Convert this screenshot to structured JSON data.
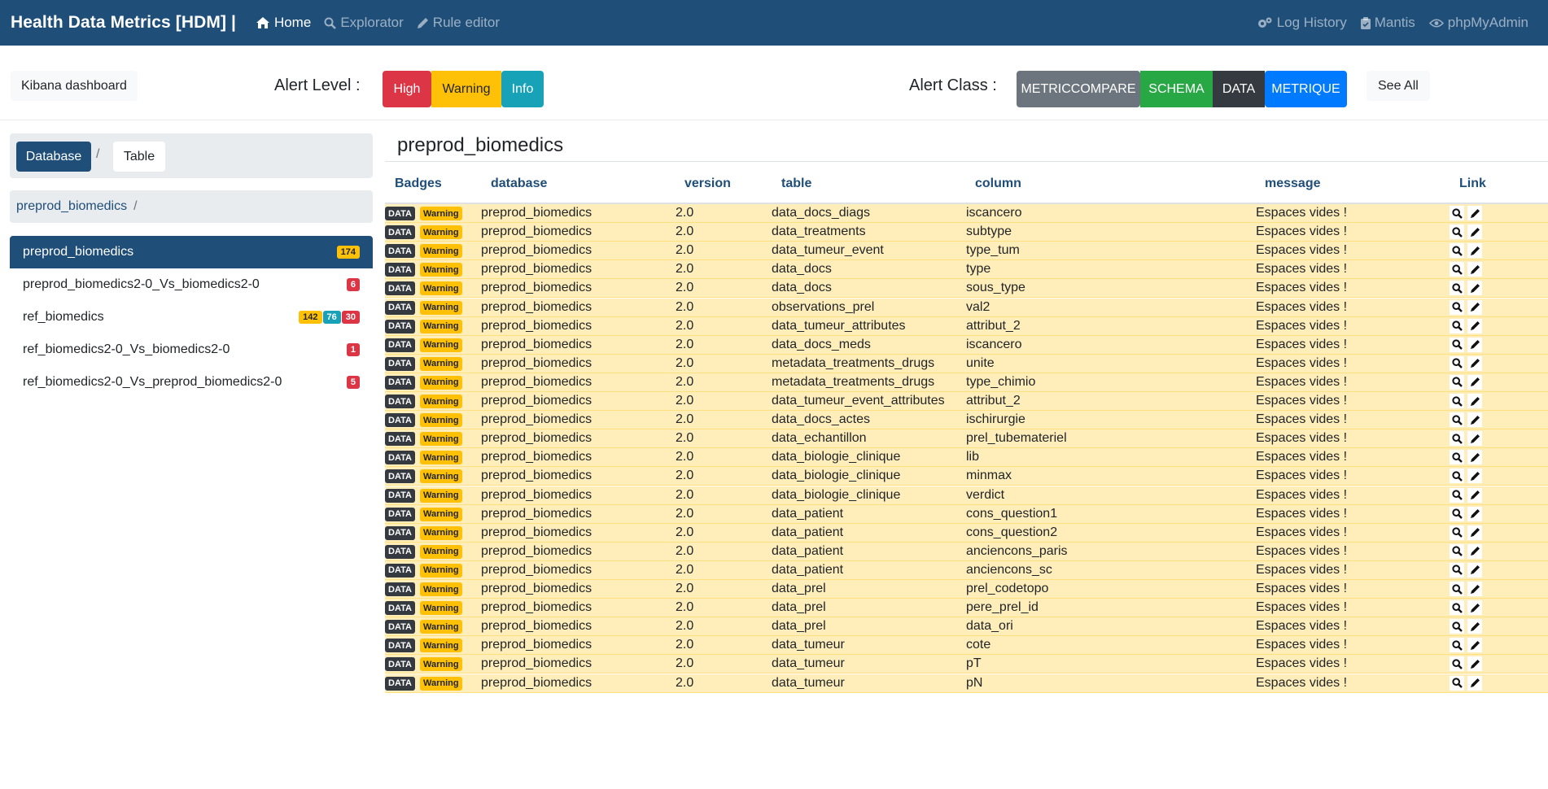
{
  "navbar": {
    "brand": "Health Data Metrics [HDM] |",
    "links": {
      "home": "Home",
      "explorator": "Explorator",
      "rule_editor": "Rule editor"
    },
    "right": {
      "log_history": "Log History",
      "mantis": "Mantis",
      "phpmyadmin": "phpMyAdmin"
    }
  },
  "alerts": {
    "kibana": "Kibana dashboard",
    "level_label": "Alert Level :",
    "levels": {
      "high": "High",
      "warning": "Warning",
      "info": "Info"
    },
    "class_label": "Alert Class :",
    "classes": {
      "metriccompare": "METRICCOMPARE",
      "schema": "SCHEMA",
      "data": "DATA",
      "metrique": "METRIQUE"
    },
    "see_all": "See All",
    "colors": {
      "high": "#dc3545",
      "warning": "#ffc107",
      "info": "#17a2b8",
      "metriccompare": "#6c757d",
      "schema": "#28a745",
      "data": "#343a40",
      "metrique": "#007bff"
    }
  },
  "left": {
    "crumbs": {
      "database": "Database",
      "separator": "/",
      "table": "Table"
    },
    "path": {
      "db": "preprod_biomedics",
      "separator": "/"
    },
    "databases": [
      {
        "name": "preprod_biomedics",
        "badges": [
          {
            "v": "174",
            "t": "y"
          }
        ]
      },
      {
        "name": "preprod_biomedics2-0_Vs_biomedics2-0",
        "badges": [
          {
            "v": "6",
            "t": "r"
          }
        ]
      },
      {
        "name": "ref_biomedics",
        "badges": [
          {
            "v": "142",
            "t": "y"
          },
          {
            "v": "76",
            "t": "c"
          },
          {
            "v": "30",
            "t": "r"
          }
        ]
      },
      {
        "name": "ref_biomedics2-0_Vs_biomedics2-0",
        "badges": [
          {
            "v": "1",
            "t": "r"
          }
        ]
      },
      {
        "name": "ref_biomedics2-0_Vs_preprod_biomedics2-0",
        "badges": [
          {
            "v": "5",
            "t": "r"
          }
        ]
      }
    ]
  },
  "main": {
    "title": "preprod_biomedics",
    "headers": {
      "badges": "Badges",
      "database": "database",
      "version": "version",
      "table": "table",
      "column": "column",
      "message": "message",
      "link": "Link"
    },
    "row_badges": {
      "data": "DATA",
      "warning": "Warning"
    },
    "row_common": {
      "database": "preprod_biomedics",
      "version": "2.0",
      "message": "Espaces vides !"
    },
    "rows": [
      {
        "table": "data_docs_diags",
        "column": "iscancero"
      },
      {
        "table": "data_treatments",
        "column": "subtype"
      },
      {
        "table": "data_tumeur_event",
        "column": "type_tum"
      },
      {
        "table": "data_docs",
        "column": "type"
      },
      {
        "table": "data_docs",
        "column": "sous_type"
      },
      {
        "table": "observations_prel",
        "column": "val2"
      },
      {
        "table": "data_tumeur_attributes",
        "column": "attribut_2"
      },
      {
        "table": "data_docs_meds",
        "column": "iscancero"
      },
      {
        "table": "metadata_treatments_drugs",
        "column": "unite"
      },
      {
        "table": "metadata_treatments_drugs",
        "column": "type_chimio"
      },
      {
        "table": "data_tumeur_event_attributes",
        "column": "attribut_2"
      },
      {
        "table": "data_docs_actes",
        "column": "ischirurgie"
      },
      {
        "table": "data_echantillon",
        "column": "prel_tubemateriel"
      },
      {
        "table": "data_biologie_clinique",
        "column": "lib"
      },
      {
        "table": "data_biologie_clinique",
        "column": "minmax"
      },
      {
        "table": "data_biologie_clinique",
        "column": "verdict"
      },
      {
        "table": "data_patient",
        "column": "cons_question1"
      },
      {
        "table": "data_patient",
        "column": "cons_question2"
      },
      {
        "table": "data_patient",
        "column": "anciencons_paris"
      },
      {
        "table": "data_patient",
        "column": "anciencons_sc"
      },
      {
        "table": "data_prel",
        "column": "prel_codetopo"
      },
      {
        "table": "data_prel",
        "column": "pere_prel_id"
      },
      {
        "table": "data_prel",
        "column": "data_ori"
      },
      {
        "table": "data_tumeur",
        "column": "cote"
      },
      {
        "table": "data_tumeur",
        "column": "pT"
      },
      {
        "table": "data_tumeur",
        "column": "pN"
      }
    ]
  }
}
